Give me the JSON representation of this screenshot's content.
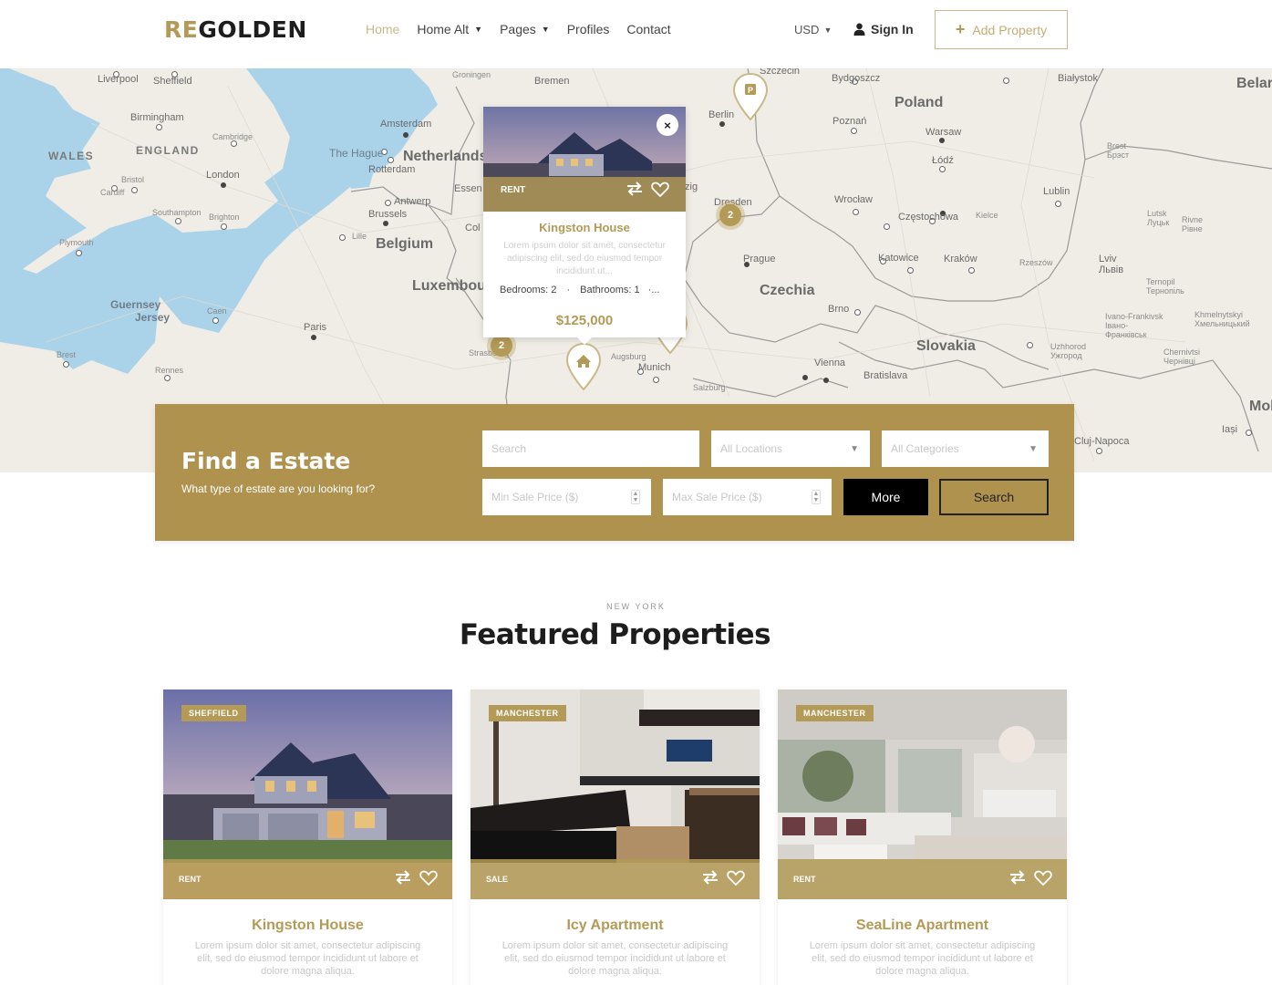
{
  "header": {
    "logo_accent": "RE",
    "logo_rest": "GOLDEN",
    "nav": [
      {
        "label": "Home",
        "active": true,
        "dropdown": false
      },
      {
        "label": "Home Alt",
        "active": false,
        "dropdown": true
      },
      {
        "label": "Pages",
        "active": false,
        "dropdown": true
      },
      {
        "label": "Profiles",
        "active": false,
        "dropdown": false
      },
      {
        "label": "Contact",
        "active": false,
        "dropdown": false
      }
    ],
    "currency": "USD",
    "sign_in": "Sign In",
    "add_property": "Add Property"
  },
  "map": {
    "labels": {
      "liverpool": "Liverpool",
      "sheffield": "Sheffield",
      "birmingham": "Birmingham",
      "wales": "WALES",
      "england": "ENGLAND",
      "cambridge": "Cambridge",
      "london": "London",
      "bristol": "Bristol",
      "cardiff": "Cardiff",
      "southampton": "Southampton",
      "brighton": "Brighton",
      "plymouth": "Plymouth",
      "guernsey": "Guernsey",
      "jersey": "Jersey",
      "caen": "Caen",
      "paris": "Paris",
      "brest": "Brest",
      "rennes": "Rennes",
      "groningen": "Groningen",
      "bremen": "Bremen",
      "amsterdam": "Amsterdam",
      "the_hague": "The Hague",
      "netherlands": "Netherlands",
      "rotterdam": "Rotterdam",
      "antwerp": "Antwerp",
      "brussels": "Brussels",
      "belgium": "Belgium",
      "luxembourg": "Luxembourg",
      "essen": "Essen",
      "cologne": "Col",
      "lille": "Lille",
      "strasbourg": "Strasbourg",
      "szczecin": "Szczecin",
      "berlin": "Berlin",
      "leipzig": "zig",
      "dresden": "Dresden",
      "bydgoszcz": "Bydgoszcz",
      "poland": "Poland",
      "poznan": "Poznań",
      "warsaw": "Warsaw",
      "lodz": "Łódź",
      "bialystok": "Białystok",
      "brest_by": "Brest Брэст",
      "wroclaw": "Wrocław",
      "czestochowa": "Częstochowa",
      "kielce": "Kielce",
      "lublin": "Lublin",
      "prague": "Prague",
      "czechia": "Czechia",
      "katowice": "Katowice",
      "krakow": "Kraków",
      "rzeszow": "Rzeszów",
      "brno": "Brno",
      "slovakia": "Slovakia",
      "vienna": "Vienna",
      "bratislava": "Bratislava",
      "augsburg": "Augsburg",
      "munich": "Munich",
      "salzburg": "Salzburg",
      "lutsk": "Lutsk Луцьк",
      "rivne": "Rivne Рівне",
      "lviv": "Lviv Львів",
      "ternopil": "Ternopil Тернопіль",
      "ivano": "Ivano-Frankivsk Івано-Франківськ",
      "khmelnytskyi": "Khmelnytskyi Хмельницький",
      "uzhhorod": "Uzhhorod Ужгород",
      "chernivtsi": "Chernivtsi Чернівці",
      "belarus": "Belar",
      "moldova": "Mol",
      "iasi": "Iași",
      "cluj": "Cluj-Napoca"
    },
    "clusters": [
      "2",
      "2"
    ],
    "pin_p_label": "P",
    "popup": {
      "badge": "RENT",
      "close_symbol": "×",
      "title": "Kingston House",
      "description": "Lorem ipsum dolor sit amet, consectetur adipiscing elit, sed do eiusmod tempor incididunt ut...",
      "bedrooms": "Bedrooms: 2",
      "bathrooms": "Bathrooms: 1",
      "specs_more": "·...",
      "price": "$125,000"
    }
  },
  "search": {
    "title": "Find a Estate",
    "subtitle": "What type of estate are you looking for?",
    "search_placeholder": "Search",
    "locations": "All Locations",
    "categories": "All Categories",
    "min_price_placeholder": "Min Sale Price ($)",
    "max_price_placeholder": "Max Sale Price ($)",
    "more_label": "More",
    "search_label": "Search"
  },
  "featured": {
    "eyebrow": "NEW YORK",
    "title": "Featured Properties",
    "cards": [
      {
        "location": "SHEFFIELD",
        "type": "RENT",
        "title": "Kingston House",
        "description": "Lorem ipsum dolor sit amet, consectetur adipiscing elit, sed do eiusmod tempor incididunt ut labore et dolore magna aliqua."
      },
      {
        "location": "MANCHESTER",
        "type": "SALE",
        "title": "Icy Apartment",
        "description": "Lorem ipsum dolor sit amet, consectetur adipiscing elit, sed do eiusmod tempor incididunt ut labore et dolore magna aliqua."
      },
      {
        "location": "MANCHESTER",
        "type": "RENT",
        "title": "SeaLine Apartment",
        "description": "Lorem ipsum dolor sit amet, consectetur adipiscing elit, sed do eiusmod tempor incididunt ut labore et dolore magna aliqua."
      }
    ]
  },
  "colors": {
    "accent": "#b39a56",
    "panel": "#b0924f",
    "map_water": "#aad3ea",
    "map_land": "#efece4"
  }
}
